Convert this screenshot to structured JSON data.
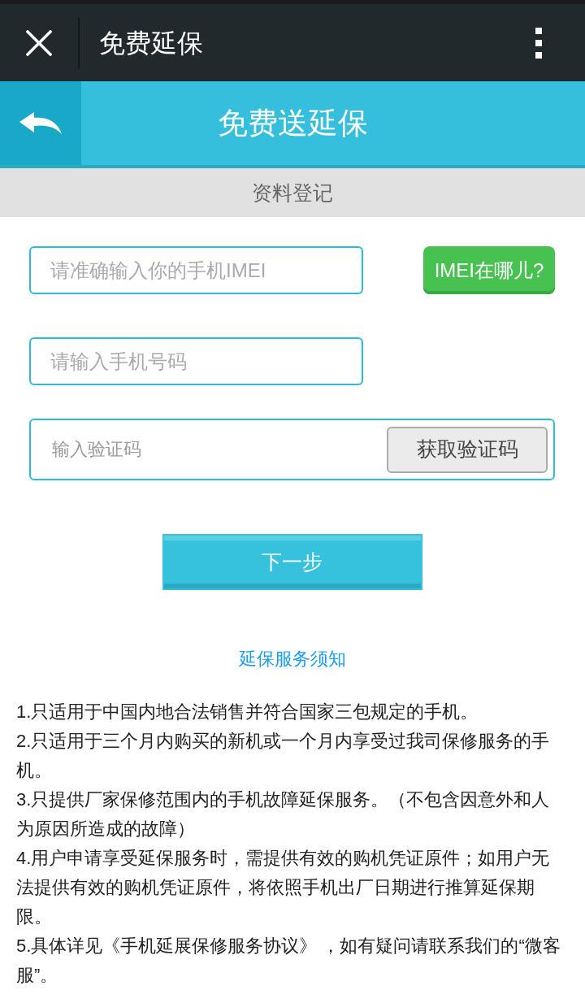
{
  "top_bar": {
    "title": "免费延保"
  },
  "header": {
    "title": "免费送延保"
  },
  "section": {
    "title": "资料登记"
  },
  "form": {
    "imei_field": {
      "placeholder": "请准确输入你的手机IMEI"
    },
    "imei_help_button": "IMEI在哪儿?",
    "phone_field": {
      "placeholder": "请输入手机号码"
    },
    "code_field": {
      "placeholder": "输入验证码"
    },
    "get_code_button": "获取验证码",
    "next_button": "下一步"
  },
  "notice_link": "延保服务须知",
  "terms": [
    "1.只适用于中国内地合法销售并符合国家三包规定的手机。",
    "2.只适用于三个月内购买的新机或一个月内享受过我司保修服务的手机。",
    "3.只提供厂家保修范围内的手机故障延保服务。（不包含因意外和人为原因所造成的故障）",
    "4.用户申请享受延保服务时，需提供有效的购机凭证原件；如用户无法提供有效的购机凭证原件，将依照手机出厂日期进行推算延保期限。",
    "5.具体详见《手机延展保修服务协议》 ，如有疑问请联系我们的“微客服”。"
  ]
}
